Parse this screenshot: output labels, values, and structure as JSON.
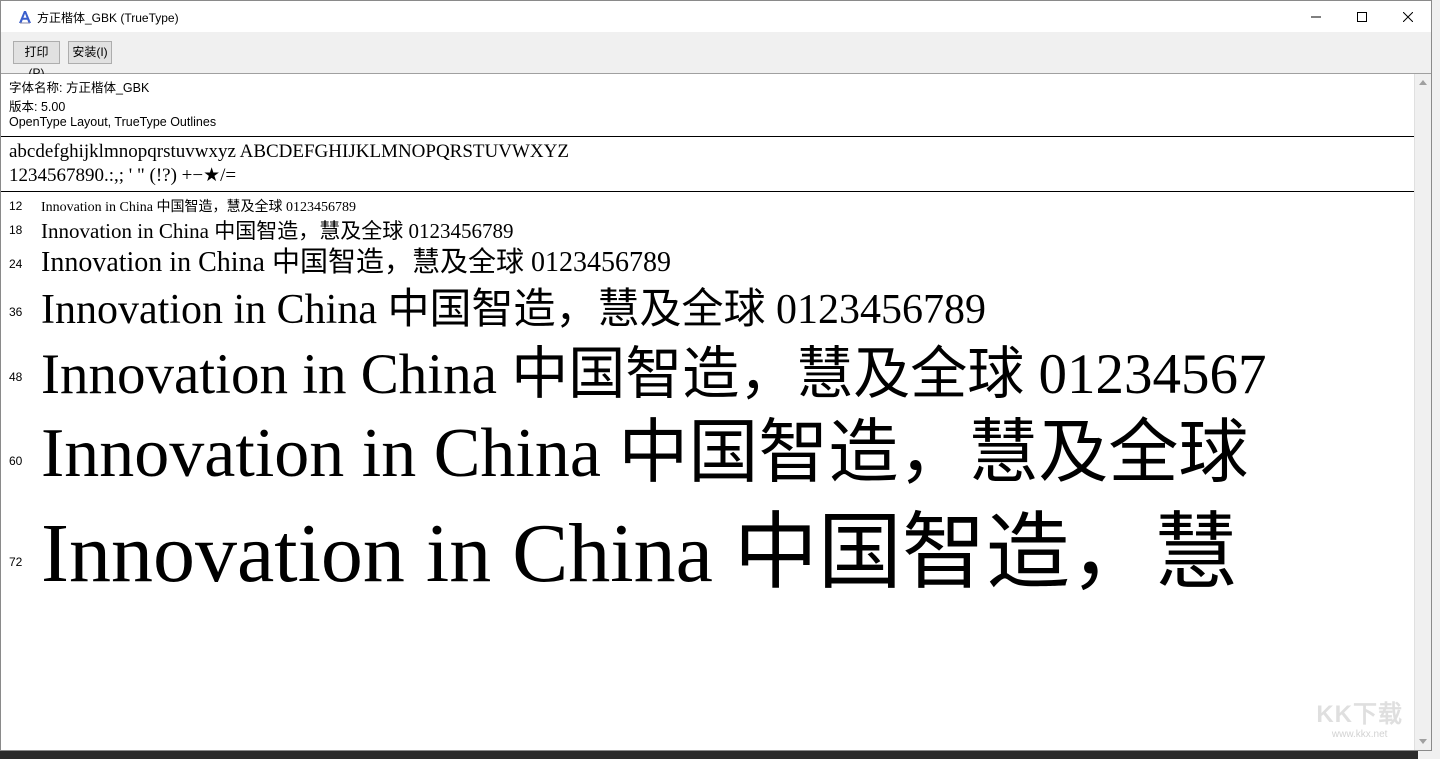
{
  "window": {
    "title": "方正楷体_GBK (TrueType)"
  },
  "toolbar": {
    "print_label": "打印(P)",
    "install_label": "安装(I)"
  },
  "font_info": {
    "name_line": "字体名称: 方正楷体_GBK",
    "version_line": "版本: 5.00",
    "type_line": "OpenType Layout, TrueType Outlines"
  },
  "charset": {
    "letters": "abcdefghijklmnopqrstuvwxyz ABCDEFGHIJKLMNOPQRSTUVWXYZ",
    "digits_symbols": "1234567890.:,; ' \" (!?) +−★/="
  },
  "samples": [
    {
      "size": "12",
      "text": "Innovation in China 中国智造，慧及全球 0123456789"
    },
    {
      "size": "18",
      "text": "Innovation in China 中国智造，慧及全球 0123456789"
    },
    {
      "size": "24",
      "text": "Innovation in China 中国智造，慧及全球 0123456789"
    },
    {
      "size": "36",
      "text": "Innovation in China 中国智造，慧及全球 0123456789"
    },
    {
      "size": "48",
      "text": "Innovation in China 中国智造，慧及全球 01234567"
    },
    {
      "size": "60",
      "text": "Innovation in China 中国智造，慧及全球"
    },
    {
      "size": "72",
      "text": "Innovation in China 中国智造，慧"
    }
  ],
  "watermark": {
    "main": "KK下载",
    "sub": "www.kkx.net"
  }
}
